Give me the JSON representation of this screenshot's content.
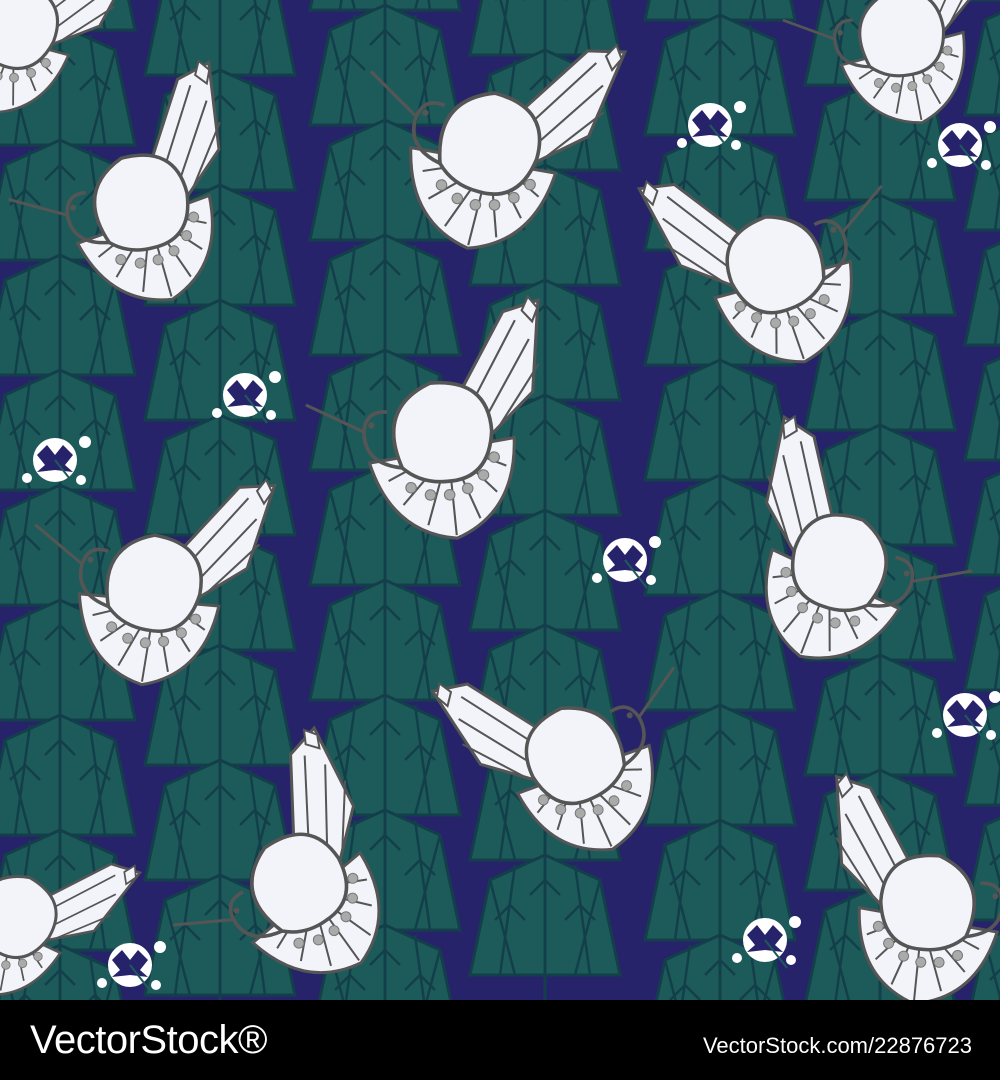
{
  "colors": {
    "background": "#27236b",
    "foliage": "#1d5b5a",
    "foliage_line": "#133f4a",
    "bird_fill": "#f2f4fa",
    "bird_line": "#555555",
    "dot": "#aaaaaa",
    "flower": "#ffffff",
    "footer_bg": "#000000",
    "footer_text": "#ffffff"
  },
  "pattern": {
    "description_icon": "crane-bird-icon",
    "flower_icon": "dandelion-flower-icon"
  },
  "footer": {
    "brand": "VectorStock®",
    "image_id": "VectorStock.com/22876723"
  }
}
